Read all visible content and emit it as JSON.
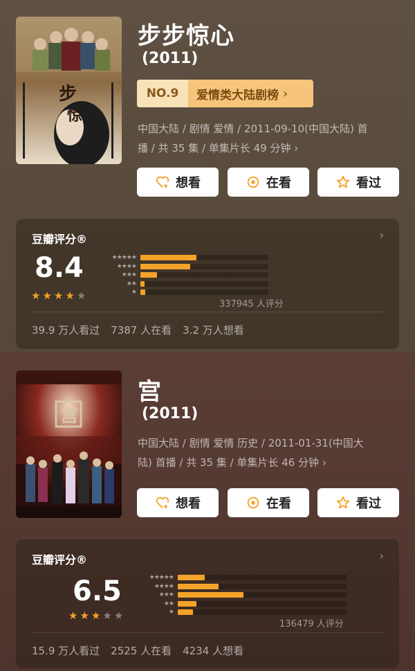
{
  "items": [
    {
      "title": "步步惊心",
      "year": "(2011)",
      "rank": {
        "no": "NO.9",
        "label": "爱情类大陆剧榜"
      },
      "meta_line1": "中国大陆 / 剧情 爱情 / 2011-09-10(中国大陆) 首",
      "meta_line2": "播 / 共 35 集 / 单集片长 49 分钟 ›",
      "buttons": {
        "want": "想看",
        "watching": "在看",
        "watched": "看过"
      },
      "rating": {
        "label": "豆瓣评分®",
        "score": "8.4",
        "stars": 4,
        "distribution": [
          0.44,
          0.39,
          0.13,
          0.03,
          0.04
        ],
        "count_text": "337945 人评分",
        "stats": [
          "39.9 万人看过",
          "7387 人在看",
          "3.2 万人想看"
        ]
      }
    },
    {
      "title": "宫",
      "year": "(2011)",
      "meta_line1": "中国大陆 / 剧情 爱情 历史 / 2011-01-31(中国大",
      "meta_line2": "陆) 首播 / 共 35 集 / 单集片长 46 分钟 ›",
      "buttons": {
        "want": "想看",
        "watching": "在看",
        "watched": "看过"
      },
      "rating": {
        "label": "豆瓣评分®",
        "score": "6.5",
        "stars": 3,
        "distribution": [
          0.16,
          0.24,
          0.39,
          0.11,
          0.09
        ],
        "count_text": "136479 人评分",
        "stats": [
          "15.9 万人看过",
          "2525 人在看",
          "4234 人想看"
        ]
      }
    }
  ],
  "star_rows": [
    "★★★★★",
    "★★★★",
    "★★★",
    "★★",
    "★"
  ],
  "icons": {
    "want": "heart-plus-icon",
    "watching": "target-icon",
    "watched": "star-outline-icon",
    "chevron": "chevron-right-icon"
  },
  "colors": {
    "bar": "#f4a32a",
    "star_on": "#f4a32a",
    "star_off": "#8a8078",
    "rank_bg": "#f6c47a"
  }
}
